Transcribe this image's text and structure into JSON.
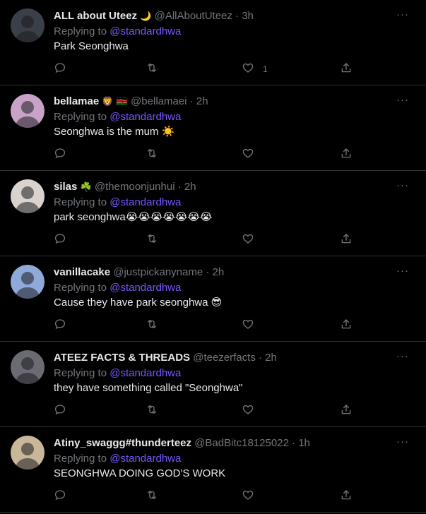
{
  "tweets": [
    {
      "name": "ALL about Uteez",
      "name_emoji": "🌙",
      "handle": "@AllAboutUteez",
      "separator": "·",
      "time": "3h",
      "replying_label": "Replying to",
      "mention": "@standardhwa",
      "text": "Park Seonghwa",
      "likes": "1",
      "avatar_icon": "avatar-person-dark",
      "avatar_color": "#3a3f48"
    },
    {
      "name": "bellamae",
      "name_emoji": "🦁 🇰🇪",
      "handle": "@bellamaei",
      "separator": "·",
      "time": "2h",
      "replying_label": "Replying to",
      "mention": "@standardhwa",
      "text": "Seonghwa is the mum ☀️",
      "likes": "",
      "avatar_icon": "avatar-person-pink",
      "avatar_color": "#c9a2c8"
    },
    {
      "name": "silas",
      "name_emoji": "☘️",
      "handle": "@themoonjunhui",
      "separator": "·",
      "time": "2h",
      "replying_label": "Replying to",
      "mention": "@standardhwa",
      "text": "park seonghwa😭😭😭😭😭😭😭",
      "likes": "",
      "avatar_icon": "avatar-person-light",
      "avatar_color": "#d8d3cc"
    },
    {
      "name": "vanillacake",
      "name_emoji": "",
      "handle": "@justpickanyname",
      "separator": "·",
      "time": "2h",
      "replying_label": "Replying to",
      "mention": "@standardhwa",
      "text": "Cause they have park seonghwa 😎",
      "likes": "",
      "avatar_icon": "avatar-person-blue",
      "avatar_color": "#8fa9d8"
    },
    {
      "name": "ATEEZ FACTS & THREADS",
      "name_emoji": "",
      "handle": "@teezerfacts",
      "separator": "·",
      "time": "2h",
      "replying_label": "Replying to",
      "mention": "@standardhwa",
      "text": "they have something called \"Seonghwa\"",
      "likes": "",
      "avatar_icon": "avatar-person-gray",
      "avatar_color": "#6b6b73"
    },
    {
      "name": "Atiny_swaggg#thunderteez",
      "name_emoji": "",
      "handle": "@BadBitc18125022",
      "separator": "·",
      "time": "1h",
      "replying_label": "Replying to",
      "mention": "@standardhwa",
      "text": "SEONGHWA DOING GOD'S WORK",
      "likes": "",
      "avatar_icon": "avatar-person-tan",
      "avatar_color": "#c9b79a"
    }
  ],
  "more_label": "···",
  "icons": {
    "reply": "reply-icon",
    "retweet": "retweet-icon",
    "like": "heart-icon",
    "share": "share-icon"
  }
}
